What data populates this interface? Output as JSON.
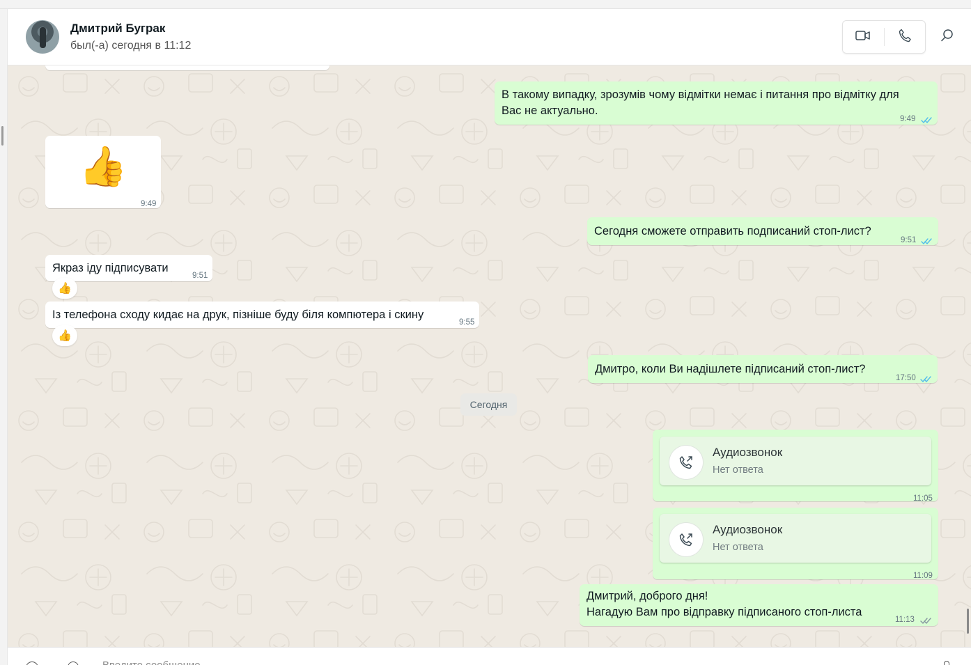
{
  "contact": {
    "name": "Дмитрий Буграк",
    "status": "был(-а) сегодня в 11:12"
  },
  "header_icons": [
    "video-call-icon",
    "voice-call-icon",
    "search-icon"
  ],
  "messages": {
    "m1": {
      "direction": "out",
      "text_line1": "В такому випадку, зрозумів чому відмітки немає і питання про відмітку для",
      "text_line2": "Вас не актуально.",
      "time": "9:49",
      "status": "read"
    },
    "m2": {
      "direction": "in",
      "emoji": "👍",
      "time": "9:49"
    },
    "m3": {
      "direction": "out",
      "text": "Сегодня сможете отправить подписаний стоп-лист?",
      "time": "9:51",
      "status": "read"
    },
    "m4": {
      "direction": "in",
      "text": "Якраз іду підписувати",
      "time": "9:51",
      "reaction": "👍"
    },
    "m5": {
      "direction": "in",
      "text": "Із телефона сходу кидає на друк, пізніше буду біля компютера і скину",
      "time": "9:55",
      "reaction": "👍"
    },
    "m6": {
      "direction": "out",
      "text": "Дмитро, коли Ви надішлете підписаний стоп-лист?",
      "time": "17:50",
      "status": "read"
    },
    "m7": {
      "direction": "out",
      "type": "call",
      "title": "Аудиозвонок",
      "subtitle": "Нет ответа",
      "time": "11:05"
    },
    "m8": {
      "direction": "out",
      "type": "call",
      "title": "Аудиозвонок",
      "subtitle": "Нет ответа",
      "time": "11:09"
    },
    "m9": {
      "direction": "out",
      "text_line1": "Дмитрий, доброго дня!",
      "text_line2": "Нагадую Вам про відправку підписаного стоп-листа",
      "time": "11:13",
      "status": "delivered"
    }
  },
  "date_separator": "Сегодня",
  "composer": {
    "placeholder": "Введите сообщение"
  },
  "colors": {
    "chat_bg": "#efeae2",
    "incoming_bubble": "#ffffff",
    "outgoing_bubble": "#d9fdd3",
    "read_ticks": "#53bdeb",
    "delivered_ticks": "#8696a0"
  }
}
